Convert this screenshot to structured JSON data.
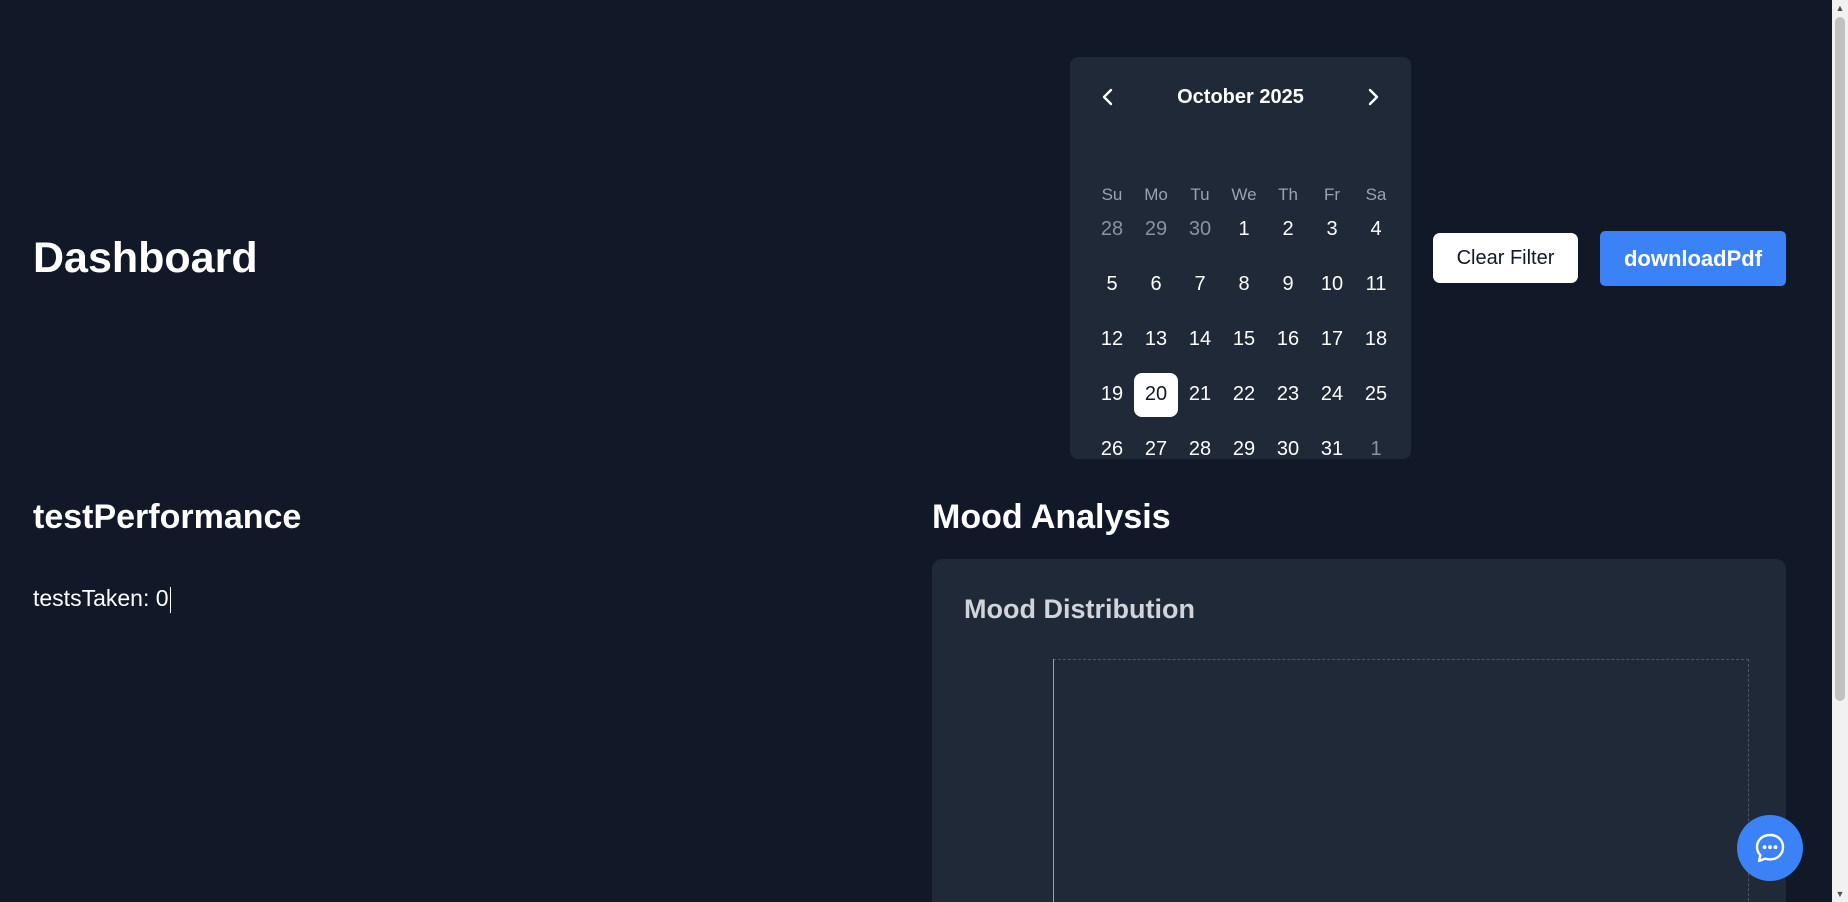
{
  "page": {
    "title": "Dashboard"
  },
  "calendar": {
    "month_label": "October 2025",
    "weekdays": [
      "Su",
      "Mo",
      "Tu",
      "We",
      "Th",
      "Fr",
      "Sa"
    ],
    "days": [
      "28",
      "29",
      "30",
      "1",
      "2",
      "3",
      "4",
      "5",
      "6",
      "7",
      "8",
      "9",
      "10",
      "11",
      "12",
      "13",
      "14",
      "15",
      "16",
      "17",
      "18",
      "19",
      "20",
      "21",
      "22",
      "23",
      "24",
      "25",
      "26",
      "27",
      "28",
      "29",
      "30",
      "31",
      "1"
    ],
    "outside_day_indices": [
      0,
      1,
      2,
      34
    ],
    "selected_day": "20"
  },
  "actions": {
    "clear_filter_label": "Clear Filter",
    "download_pdf_label": "downloadPdf"
  },
  "test_performance": {
    "heading": "testPerformance",
    "tests_taken_label": "testsTaken:",
    "tests_taken_value": "0"
  },
  "mood": {
    "heading": "Mood Analysis",
    "card_title": "Mood Distribution"
  },
  "colors": {
    "background": "#111827",
    "card": "#1f2937",
    "accent": "#3b82f6"
  },
  "icons": {
    "prev": "chevron-left-icon",
    "next": "chevron-right-icon",
    "chat": "chat-bubble-icon"
  }
}
